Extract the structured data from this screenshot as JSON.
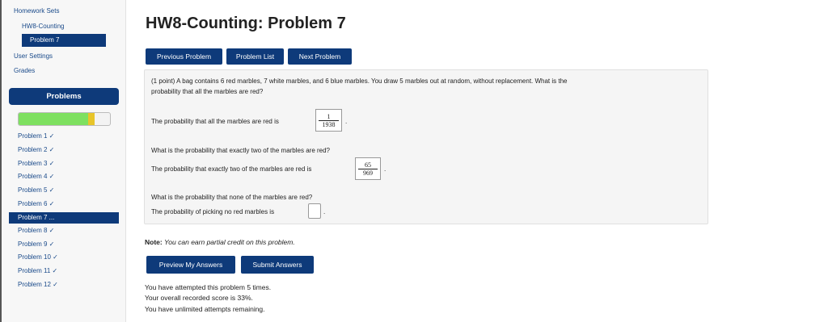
{
  "sidebar": {
    "homework_sets": "Homework Sets",
    "set_name": "HW8-Counting",
    "active_problem": "Problem 7",
    "user_settings": "User Settings",
    "grades": "Grades",
    "problems_header": "Problems",
    "progress_fraction": 0.83,
    "problems": [
      "Problem 1 ✓",
      "Problem 2 ✓",
      "Problem 3 ✓",
      "Problem 4 ✓",
      "Problem 5 ✓",
      "Problem 6 ✓",
      "Problem 7 ...",
      "Problem 8 ✓",
      "Problem 9 ✓",
      "Problem 10 ✓",
      "Problem 11 ✓",
      "Problem 12 ✓"
    ]
  },
  "main": {
    "title": "HW8-Counting: Problem 7",
    "prev_button": "Previous Problem",
    "list_button": "Problem List",
    "next_button": "Next Problem",
    "problem": {
      "intro_line1": "(1 point) A bag contains 6 red marbles, 7 white marbles, and 6 blue marbles. You draw 5 marbles out at random, without replacement. What is the",
      "intro_line2": "probability that all the marbles are red?",
      "q1_text": "The probability that all the marbles are red is",
      "q1_num": "1",
      "q1_den": "1938",
      "q1_period": ".",
      "q2_question": "What is the probability that exactly two of the marbles are red?",
      "q2_text": "The probability that exactly two of the marbles are red is",
      "q2_num": "65",
      "q2_den": "969",
      "q2_period": ".",
      "q3_question": "What is the probability that none of the marbles are red?",
      "q3_text": "The probability of picking no red marbles is",
      "q3_period": "."
    },
    "note_label": "Note:",
    "note_text": "You can earn partial credit on this problem.",
    "preview_button": "Preview My Answers",
    "submit_button": "Submit Answers",
    "status": [
      "You have attempted this problem 5 times.",
      "Your overall recorded score is 33%.",
      "You have unlimited attempts remaining."
    ]
  }
}
